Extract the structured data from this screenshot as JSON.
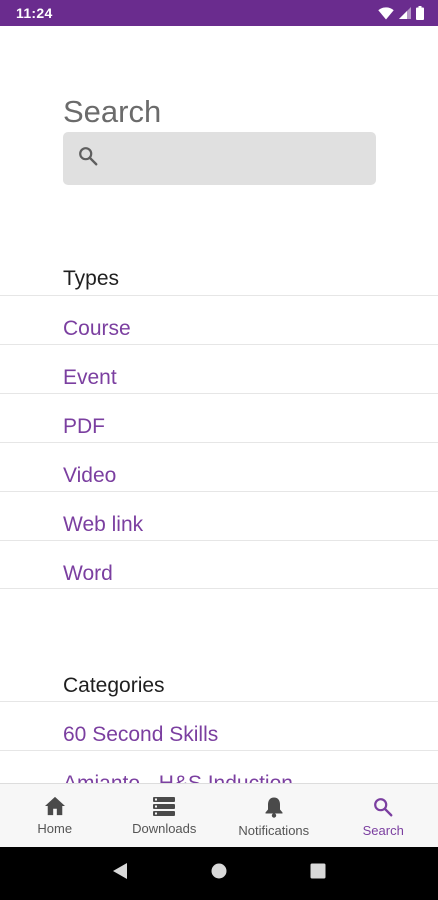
{
  "status_bar": {
    "time": "11:24",
    "icons": [
      "wifi-icon",
      "signal-icon",
      "battery-icon"
    ]
  },
  "search": {
    "title": "Search",
    "value": "",
    "placeholder": ""
  },
  "types": {
    "heading": "Types",
    "items": [
      "Course",
      "Event",
      "PDF",
      "Video",
      "Web link",
      "Word"
    ]
  },
  "categories": {
    "heading": "Categories",
    "items": [
      "60 Second Skills",
      "Amianto - H&S Induction"
    ]
  },
  "bottom_nav": {
    "items": [
      {
        "label": "Home",
        "icon": "home-icon",
        "active": false
      },
      {
        "label": "Downloads",
        "icon": "downloads-icon",
        "active": false
      },
      {
        "label": "Notifications",
        "icon": "bell-icon",
        "active": false
      },
      {
        "label": "Search",
        "icon": "search-icon",
        "active": true
      }
    ]
  },
  "colors": {
    "status_bar": "#6a2c8e",
    "accent": "#7b3fa0",
    "search_box": "#e0e0e0",
    "nav_background": "#f7f7f7"
  }
}
